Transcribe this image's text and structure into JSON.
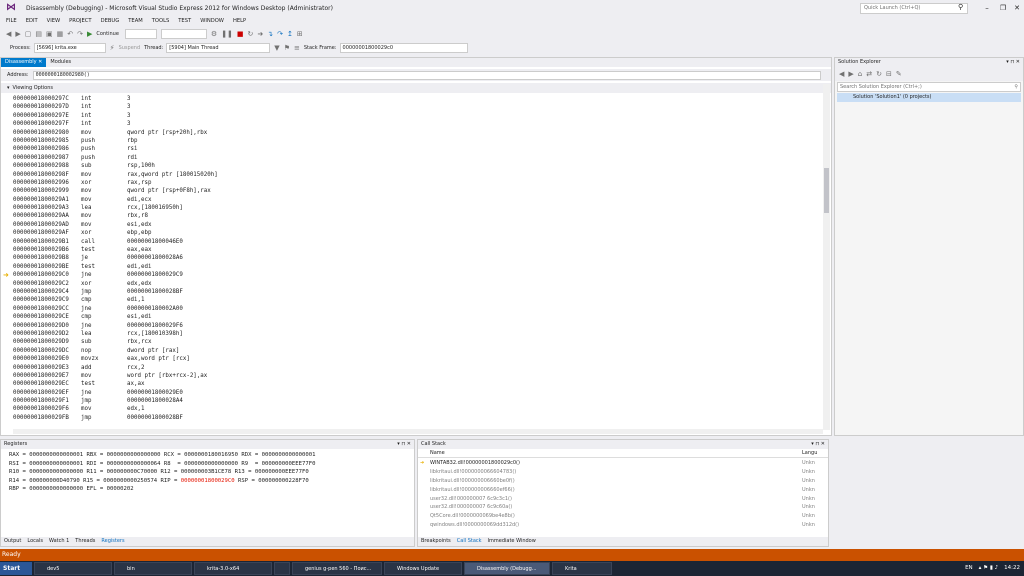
{
  "window": {
    "title": "Disassembly (Debugging) - Microsoft Visual Studio Express 2012 for Windows Desktop (Administrator)",
    "quick_launch_placeholder": "Quick Launch (Ctrl+Q)"
  },
  "menu": [
    "FILE",
    "EDIT",
    "VIEW",
    "PROJECT",
    "DEBUG",
    "TEAM",
    "TOOLS",
    "TEST",
    "WINDOW",
    "HELP"
  ],
  "toolbar": {
    "continue_label": "Continue"
  },
  "debug_location": {
    "process_label": "Process:",
    "process_value": "[5696] krita.exe",
    "suspend_label": "Suspend",
    "thread_label": "Thread:",
    "thread_value": "[5904] Main Thread",
    "stack_label": "Stack Frame:",
    "stack_value": "0000000180002​9c0"
  },
  "tabs": [
    {
      "label": "Disassembly"
    },
    {
      "label": "Modules"
    }
  ],
  "address": {
    "label": "Address:",
    "value": "0000000180002980()"
  },
  "viewing_options": "Viewing Options",
  "disasm": [
    [
      "000000018000297C",
      "int",
      "3"
    ],
    [
      "000000018000297D",
      "int",
      "3"
    ],
    [
      "000000018000297E",
      "int",
      "3"
    ],
    [
      "000000018000297F",
      "int",
      "3"
    ],
    [
      "0000000180002980",
      "mov",
      "qword ptr [rsp+20h],rbx"
    ],
    [
      "0000000180002985",
      "push",
      "rbp"
    ],
    [
      "0000000180002986",
      "push",
      "rsi"
    ],
    [
      "0000000180002987",
      "push",
      "rdi"
    ],
    [
      "0000000180002988",
      "sub",
      "rsp,100h"
    ],
    [
      "000000018000298F",
      "mov",
      "rax,qword ptr [180015020h]"
    ],
    [
      "0000000180002996",
      "xor",
      "rax,rsp"
    ],
    [
      "0000000180002999",
      "mov",
      "qword ptr [rsp+0F8h],rax"
    ],
    [
      "00000001800029A1",
      "mov",
      "edi,ecx"
    ],
    [
      "00000001800029A3",
      "lea",
      "rcx,[180016950h]"
    ],
    [
      "00000001800029AA",
      "mov",
      "rbx,r8"
    ],
    [
      "00000001800029AD",
      "mov",
      "esi,edx"
    ],
    [
      "00000001800029AF",
      "xor",
      "ebp,ebp"
    ],
    [
      "00000001800029B1",
      "call",
      "00000001800046E0"
    ],
    [
      "00000001800029B6",
      "test",
      "eax,eax"
    ],
    [
      "00000001800029B8",
      "je",
      "00000001800028A6"
    ],
    [
      "00000001800029BE",
      "test",
      "edi,edi"
    ],
    [
      "00000001800029C0",
      "jne",
      "00000001800029C9"
    ],
    [
      "00000001800029C2",
      "xor",
      "edx,edx"
    ],
    [
      "00000001800029C4",
      "jmp",
      "00000001800028BF"
    ],
    [
      "00000001800029C9",
      "cmp",
      "edi,1"
    ],
    [
      "00000001800029CC",
      "jne",
      "0000000180002A00"
    ],
    [
      "00000001800029CE",
      "cmp",
      "esi,edi"
    ],
    [
      "00000001800029D0",
      "jne",
      "00000001800029F6"
    ],
    [
      "00000001800029D2",
      "lea",
      "rcx,[180010398h]"
    ],
    [
      "00000001800029D9",
      "sub",
      "rbx,rcx"
    ],
    [
      "00000001800029DC",
      "nop",
      "dword ptr [rax]"
    ],
    [
      "00000001800029E0",
      "movzx",
      "eax,word ptr [rcx]"
    ],
    [
      "00000001800029E3",
      "add",
      "rcx,2"
    ],
    [
      "00000001800029E7",
      "mov",
      "word ptr [rbx+rcx-2],ax"
    ],
    [
      "00000001800029EC",
      "test",
      "ax,ax"
    ],
    [
      "00000001800029EF",
      "jne",
      "00000001800029E0"
    ],
    [
      "00000001800029F1",
      "jmp",
      "00000001800028A4"
    ],
    [
      "00000001800029F6",
      "mov",
      "edx,1"
    ],
    [
      "00000001800029FB",
      "jmp",
      "00000001800028BF"
    ]
  ],
  "solution_explorer": {
    "title": "Solution Explorer",
    "search_placeholder": "Search Solution Explorer (Ctrl+;)",
    "node": "Solution 'Solution1' (0 projects)"
  },
  "registers": {
    "title": "Registers",
    "line1": "RAX = 0000000000000001 RBX = 0000000000000000 RCX = 0000000180016950 RDX = 0000000000000001",
    "line2": "RSI = 0000000000000001 RDI = 0000000000000064 R8  = 0000000000000000 R9  = 000000000EEE77F0",
    "line3": "R10 = 0000000000000000 R11 = 000000000C70000 R12 = 000000003B1CE78 R13 = 000000000EEE77F0",
    "line4a": "R14 = 000000000D40790 R15 = 0000000000250574 RIP = ",
    "line4rip": "00000001800029C0",
    "line4b": " RSP = 000000000228F70",
    "line5": "RBP = 0000000000000000 EFL = 00000202"
  },
  "bottom_tabs": [
    "Output",
    "Locals",
    "Watch 1",
    "Threads",
    "Registers"
  ],
  "call_stack": {
    "title": "Call Stack",
    "col_name": "Name",
    "col_lang": "Langu",
    "rows": [
      "WINTAB32.dll!00000001800029c0()",
      "libkritaui.dll!0000000066604783()",
      "libkritaui.dll!000000006660be0f()",
      "libkritaui.dll!000000006660ef66()",
      "user32.dll!000000007 6c9c3c1()",
      "user32.dll!000000007 6c9c60a()",
      "Qt5Core.dll!0000000069be4e8b()",
      "qwindows.dll!0000000069dd312d()"
    ],
    "lang": "Unkn",
    "tabs": [
      "Breakpoints",
      "Call Stack",
      "Immediate Window"
    ]
  },
  "status": "Ready",
  "taskbar": {
    "start": "Start",
    "items": [
      "dev5",
      "bin",
      "krita-3.0-x64",
      "",
      "genius g-pen 560 - Поис...",
      "Windows Update",
      "Disassembly (Debugg...",
      "Krita"
    ],
    "lang": "EN",
    "time": "14:22"
  }
}
